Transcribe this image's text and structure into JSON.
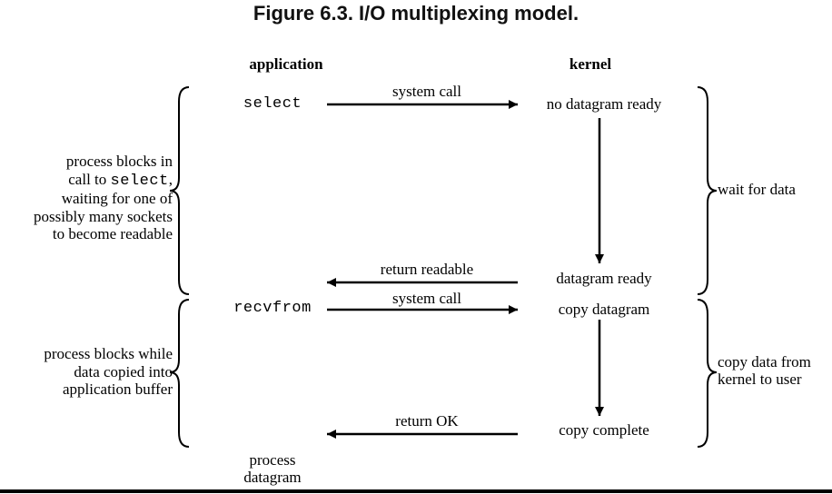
{
  "title": "Figure 6.3. I/O multiplexing model.",
  "header_application": "application",
  "header_kernel": "kernel",
  "app_select": "select",
  "app_recvfrom": "recvfrom",
  "app_process_datagram": "process\ndatagram",
  "arrow_system_call_1": "system call",
  "arrow_return_readable": "return readable",
  "arrow_system_call_2": "system call",
  "arrow_return_ok": "return OK",
  "kernel_no_datagram": "no datagram ready",
  "kernel_datagram_ready": "datagram ready",
  "kernel_copy_datagram": "copy datagram",
  "kernel_copy_complete": "copy complete",
  "right_wait": "wait for data",
  "right_copy": "copy data from\nkernel to user",
  "note1_l1": "process blocks in",
  "note1_l2a": "call to ",
  "note1_l2b": "select",
  "note1_l2c": ",",
  "note1_l3": "waiting for one of",
  "note1_l4": "possibly many sockets",
  "note1_l5": "to become readable",
  "note2_l1": "process blocks while",
  "note2_l2": "data copied into",
  "note2_l3": "application buffer"
}
